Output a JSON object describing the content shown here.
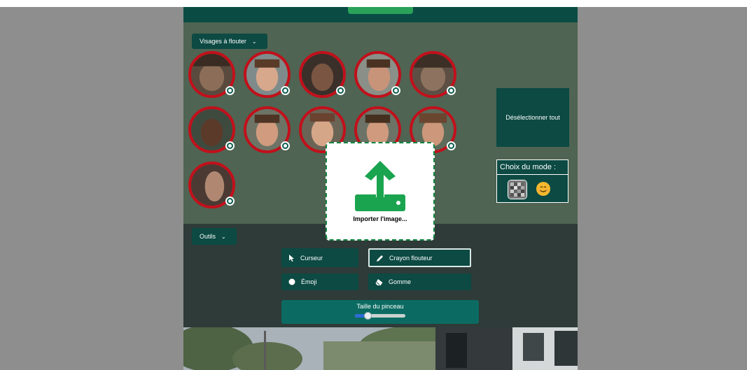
{
  "faces_dropdown": {
    "label": "Visages à flouter"
  },
  "faces": [
    {
      "id": 1
    },
    {
      "id": 2
    },
    {
      "id": 3
    },
    {
      "id": 4
    },
    {
      "id": 5
    },
    {
      "id": 6
    },
    {
      "id": 7
    },
    {
      "id": 8
    },
    {
      "id": 9
    },
    {
      "id": 10
    },
    {
      "id": 11
    }
  ],
  "deselect_button": {
    "label": "Désélectionner tout"
  },
  "mode": {
    "title": "Choix du mode :",
    "options": [
      "blur-mosaic-icon",
      "smiley-emoji-icon"
    ]
  },
  "tools_dropdown": {
    "label": "Outils"
  },
  "tools": {
    "cursor": "Curseur",
    "pencil": "Crayon flouteur",
    "emoji": "Émoji",
    "eraser": "Gomme"
  },
  "brush": {
    "label": "Taille du pinceau",
    "value_fraction": 0.25
  },
  "upload": {
    "label": "Importer l'image..."
  },
  "colors": {
    "accent": "#0c4a43",
    "selected_border": "#c2101b",
    "upload_green": "#1aa44f"
  }
}
